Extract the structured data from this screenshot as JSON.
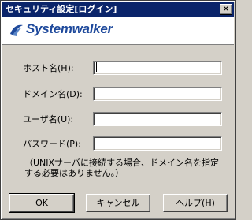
{
  "window": {
    "title": "セキュリティ設定[ログイン]",
    "close_glyph": "×"
  },
  "banner": {
    "brand": "Systemwalker",
    "brand_color": "#1f4a9c"
  },
  "form": {
    "host_label": "ホスト名(H):",
    "domain_label": "ドメイン名(D):",
    "user_label": "ユーザ名(U):",
    "password_label": "パスワード(P):",
    "host_value": "",
    "domain_value": "",
    "user_value": "",
    "password_value": ""
  },
  "note": "（UNIXサーバに接続する場合、ドメイン名を指定する必要はありません。）",
  "buttons": {
    "ok": "OK",
    "cancel": "キャンセル",
    "help": "ヘルプ(H)"
  }
}
